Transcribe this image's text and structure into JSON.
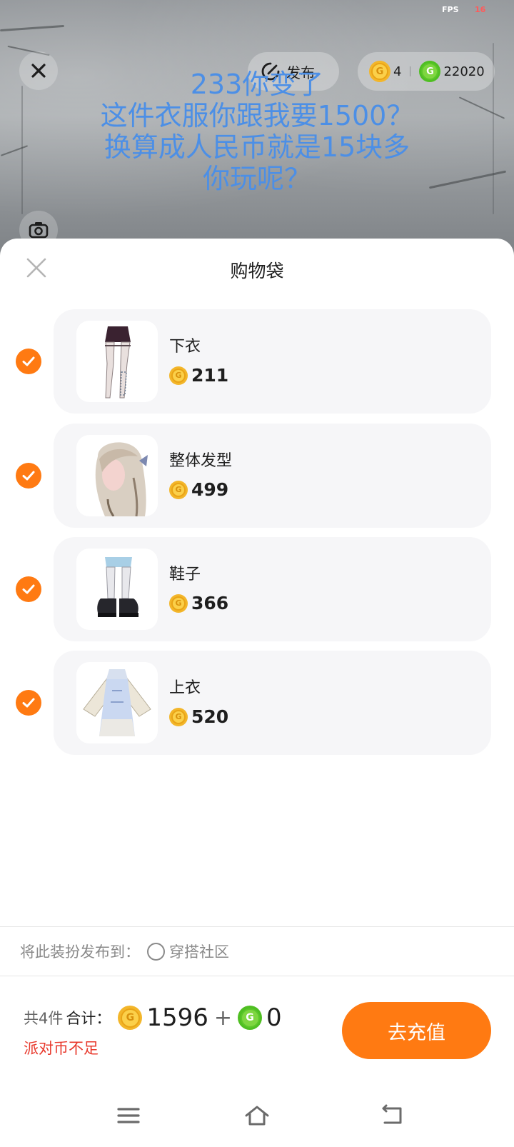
{
  "status": {
    "fps_label": "FPS",
    "fps_value": "16"
  },
  "top_bar": {
    "publish_label": "发布",
    "gold_balance": "4",
    "green_balance": "22020"
  },
  "overlay_text": [
    "233你变了",
    "这件衣服你跟我要1500？",
    "换算成人民币就是15块多",
    "你玩呢？"
  ],
  "sheet": {
    "title": "购物袋",
    "items": [
      {
        "name": "下衣",
        "price": "211",
        "checked": true,
        "thumb_icon": "skirt-thumbnail"
      },
      {
        "name": "整体发型",
        "price": "499",
        "checked": true,
        "thumb_icon": "hairstyle-thumbnail"
      },
      {
        "name": "鞋子",
        "price": "366",
        "checked": true,
        "thumb_icon": "shoes-thumbnail"
      },
      {
        "name": "上衣",
        "price": "520",
        "checked": true,
        "thumb_icon": "top-thumbnail"
      }
    ],
    "publish_to_label": "将此装扮发布到：",
    "publish_option": "穿搭社区",
    "count_text": "共4件",
    "total_label": "合计：",
    "gold_total": "1596",
    "plus": "+",
    "green_total": "0",
    "warning": "派对币不足",
    "recharge_label": "去充值"
  },
  "colors": {
    "accent": "#ff7a12",
    "warning": "#e8392c",
    "overlay_text": "#4c8fe6",
    "gold_coin": "#f3b62a",
    "green_coin": "#4fbf22"
  },
  "nav": {
    "icons": [
      "menu-icon",
      "home-icon",
      "back-icon"
    ]
  }
}
